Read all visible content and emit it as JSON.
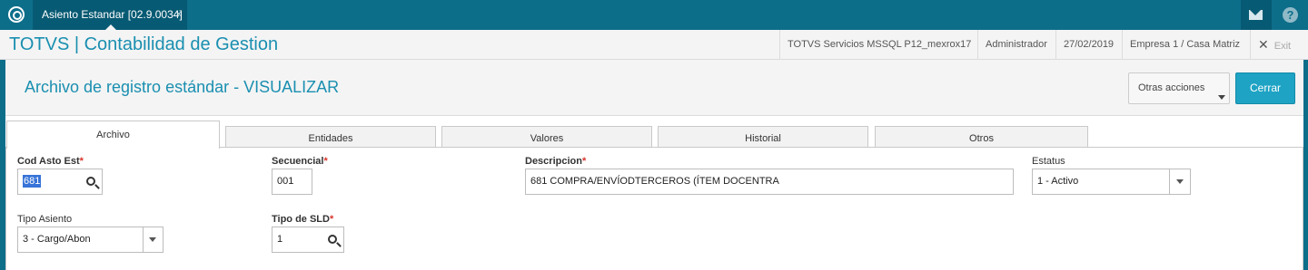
{
  "topbar": {
    "tab_label": "Asiento Estandar [02.9.0034]",
    "tab_close": "×",
    "help": "?"
  },
  "header": {
    "app_title": "TOTVS | Contabilidad de Gestion",
    "server": "TOTVS Servicios MSSQL P12_mexrox17",
    "user": "Administrador",
    "date": "27/02/2019",
    "company": "Empresa 1 / Casa Matriz",
    "exit_icon": "✕",
    "exit_label": "Exit"
  },
  "page": {
    "title": "Archivo de registro estándar - VISUALIZAR",
    "other_actions": "Otras acciones",
    "close": "Cerrar"
  },
  "tabs": [
    {
      "label": "Archivo"
    },
    {
      "label": "Entidades"
    },
    {
      "label": "Valores"
    },
    {
      "label": "Historial"
    },
    {
      "label": "Otros"
    }
  ],
  "form": {
    "cod_asto": {
      "label": "Cod Asto Est",
      "value": "681"
    },
    "secuencial": {
      "label": "Secuencial",
      "value": "001"
    },
    "descripcion": {
      "label": "Descripcion",
      "value": "681 COMPRA/ENVÍODTERCEROS (ÍTEM DOCENTRA"
    },
    "estatus": {
      "label": "Estatus",
      "value": "1 - Activo"
    },
    "tipo_asiento": {
      "label": "Tipo Asiento",
      "value": "3 - Cargo/Abon"
    },
    "tipo_sld": {
      "label": "Tipo de SLD",
      "value": "1"
    },
    "required_mark": "*"
  },
  "colors": {
    "topbar": "#0d6e8a",
    "accent_text": "#1a8fb0",
    "primary_button": "#1ea3c4",
    "required": "#d9342b"
  }
}
